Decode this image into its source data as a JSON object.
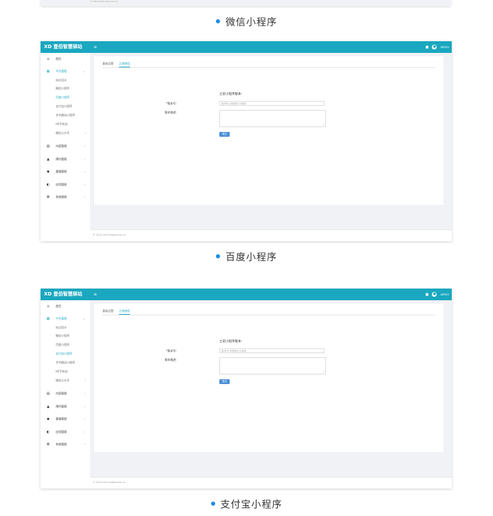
{
  "captions": [
    "微信小程序",
    "百度小程序",
    "支付宝小程序"
  ],
  "top_footer": "© 2014-2019 www.xxxx.cn",
  "colors": {
    "header": "#1aa7c0",
    "accent": "#1aa7c0",
    "button": "#4a90d9",
    "bullet": "#1a8ee6"
  },
  "shots": [
    {
      "header": {
        "logo": "XD 壹佰智慧驿站",
        "menu_icon": "≡",
        "bell_icon": "■",
        "user": "admin"
      },
      "sidebar": {
        "items": [
          {
            "icon": "home-icon",
            "glyph": "⌂",
            "label": "首页"
          },
          {
            "icon": "grid-icon",
            "glyph": "▦",
            "label": "平台管理",
            "caret": "⌄"
          },
          {
            "icon": "file-icon",
            "glyph": "▤",
            "label": "内容管理",
            "caret": "›"
          },
          {
            "icon": "bell-icon",
            "glyph": "▲",
            "label": "预约管理",
            "caret": "›"
          },
          {
            "icon": "users-icon",
            "glyph": "◆",
            "label": "客服管理",
            "caret": "›"
          },
          {
            "icon": "cube-icon",
            "glyph": "◐",
            "label": "应用管理",
            "caret": "›"
          },
          {
            "icon": "gear-icon",
            "glyph": "✿",
            "label": "系统管理",
            "caret": "›"
          }
        ],
        "sub_items": [
          "站点设计",
          "微信小程序",
          "百度小程序",
          "支付宝小程序",
          "字节跳动小程序",
          "H5手机站",
          "微信公众号"
        ],
        "sub_caret": "›"
      },
      "tabs": [
        "基础设置",
        "正常使用"
      ],
      "form": {
        "prev_version": "之前小程序版本:",
        "version_label": "*版本号:",
        "version_placeholder": "版本号,切换提示小程序",
        "desc_label": "版本描述:",
        "submit": "提交"
      },
      "footer": "© 2014-2019 www.xxxx.cn"
    },
    {
      "header": {
        "logo": "XD 壹佰智慧驿站",
        "menu_icon": "≡",
        "bell_icon": "■",
        "user": "admin"
      },
      "sidebar": {
        "items": [
          {
            "icon": "home-icon",
            "glyph": "⌂",
            "label": "首页"
          },
          {
            "icon": "grid-icon",
            "glyph": "▦",
            "label": "平台管理",
            "caret": "⌄"
          },
          {
            "icon": "file-icon",
            "glyph": "▤",
            "label": "内容管理",
            "caret": "›"
          },
          {
            "icon": "bell-icon",
            "glyph": "▲",
            "label": "预约管理",
            "caret": "›"
          },
          {
            "icon": "users-icon",
            "glyph": "◆",
            "label": "客服管理",
            "caret": "›"
          },
          {
            "icon": "cube-icon",
            "glyph": "◐",
            "label": "应用管理",
            "caret": "›"
          },
          {
            "icon": "gear-icon",
            "glyph": "✿",
            "label": "系统管理",
            "caret": "›"
          }
        ],
        "sub_items": [
          "站点设计",
          "微信小程序",
          "百度小程序",
          "支付宝小程序",
          "字节跳动小程序",
          "H5手机站",
          "微信公众号"
        ],
        "sub_caret": "›"
      },
      "tabs": [
        "基础设置",
        "正常使用"
      ],
      "form": {
        "prev_version": "之前小程序版本:",
        "version_label": "*版本号:",
        "version_placeholder": "版本号,切换提示小程序",
        "desc_label": "版本描述:",
        "submit": "提交"
      },
      "footer": "© 2014-2019 www.xxxx.cn"
    }
  ]
}
